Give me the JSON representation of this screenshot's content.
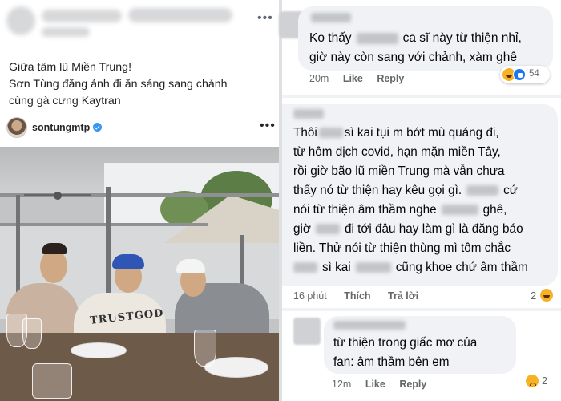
{
  "left_post": {
    "lines": [
      "Giữa tâm lũ Miền Trung!",
      "Sơn Tùng đăng ảnh đi ăn sáng sang chảnh",
      "cùng gà cưng Kaytran"
    ],
    "more_glyph": "•••"
  },
  "instagram": {
    "username": "sontungmtp",
    "more_glyph": "•••",
    "shirt_print": "TRUSTGOD"
  },
  "comments": [
    {
      "lines": [
        "Ko thấy",
        "ca sĩ này từ thiện nhỉ,",
        "giờ này còn sang với chảnh, xàm ghê"
      ],
      "time": "20m",
      "actions": [
        "Like",
        "Reply"
      ],
      "reaction_count": "54",
      "reaction_icons": [
        "haha-icon",
        "like-icon"
      ]
    },
    {
      "lines": [
        "Thôi",
        "sì kai tụi m bớt mù quáng đi,",
        "từ hôm dịch covid, hạn mặn miền Tây,",
        "rồi giờ bão lũ miền Trung mà vẫn chưa",
        "thấy nó từ thiện hay kêu gọi gì.",
        "cứ",
        "nói từ thiện âm thầm nghe",
        "ghê,",
        "giờ",
        "đi tới đâu hay làm gì là đăng báo",
        "liền. Thử nói từ thiện thùng mì tôm chắc",
        "sì kai",
        "cũng khoe chứ âm thầm"
      ],
      "time": "16 phút",
      "actions": [
        "Thích",
        "Trả lời"
      ],
      "reaction_count": "2",
      "reaction_icons": [
        "haha-icon"
      ]
    },
    {
      "lines": [
        "từ thiện trong giấc mơ của",
        "fan: âm thầm bên em"
      ],
      "time": "12m",
      "actions": [
        "Like",
        "Reply"
      ],
      "reaction_count": "2",
      "reaction_icons": [
        "sad-icon"
      ]
    }
  ]
}
